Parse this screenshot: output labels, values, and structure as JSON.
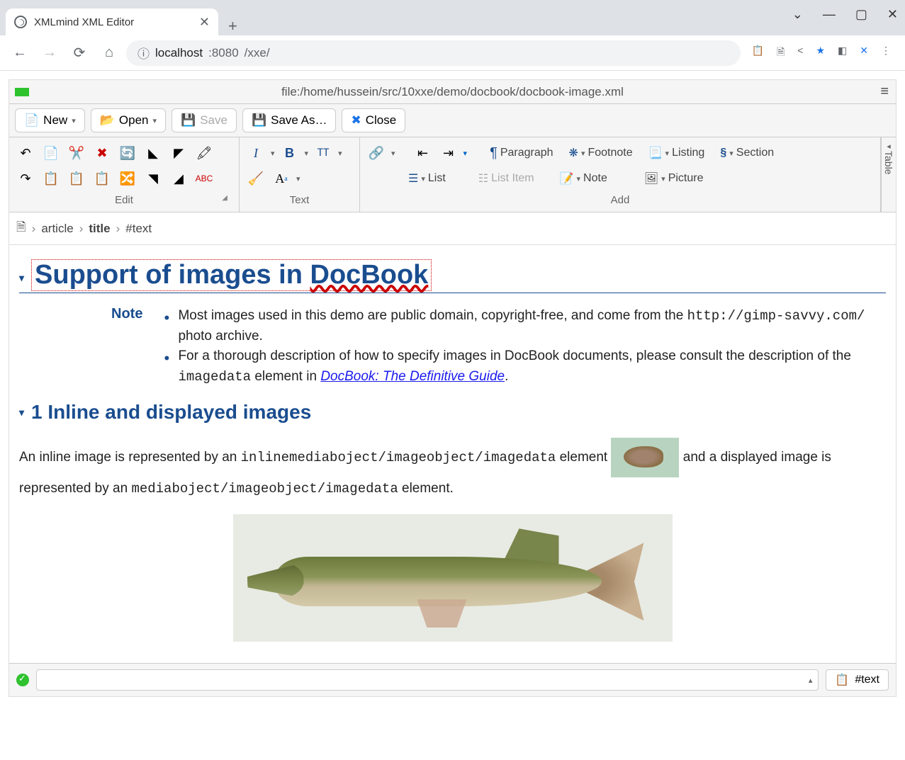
{
  "browser": {
    "tab_title": "XMLmind XML Editor",
    "url_host": "localhost",
    "url_port": ":8080",
    "url_path": "/xxe/"
  },
  "app": {
    "file_path": "file:/home/hussein/src/10xxe/demo/docbook/docbook-image.xml",
    "toolbar": {
      "new": "New",
      "open": "Open",
      "save": "Save",
      "save_as": "Save As…",
      "close": "Close"
    },
    "ribbon": {
      "edit_label": "Edit",
      "text_label": "Text",
      "add_label": "Add",
      "table_label": "Table",
      "paragraph": "Paragraph",
      "footnote": "Footnote",
      "listing": "Listing",
      "section": "Section",
      "list": "List",
      "list_item": "List Item",
      "note": "Note",
      "picture": "Picture"
    },
    "breadcrumbs": [
      "article",
      "title",
      "#text"
    ]
  },
  "doc": {
    "title_pre": "Support of images in ",
    "title_link": "DocBook",
    "note_label": "Note",
    "note_items": [
      {
        "text_a": "Most images used in this demo are public domain, copyright-free, and come from the ",
        "mono": "http://gimp-savvy.com/",
        "text_b": " photo archive."
      },
      {
        "text_a": "For a thorough description of how to specify images in DocBook documents, please consult the description of the ",
        "mono": "imagedata",
        "text_b": " element in ",
        "link": "DocBook: The Definitive Guide",
        "tail": "."
      }
    ],
    "section1": "1 Inline and displayed images",
    "para": {
      "a": "An inline image is represented by an ",
      "mono1": "inlinemediaboject/imageobject/imagedata",
      "b": " element ",
      "c": " and a displayed image is represented by an ",
      "mono2": "mediaboject/imageobject/imagedata",
      "d": " element."
    }
  },
  "status": {
    "clipboard": "#text"
  }
}
